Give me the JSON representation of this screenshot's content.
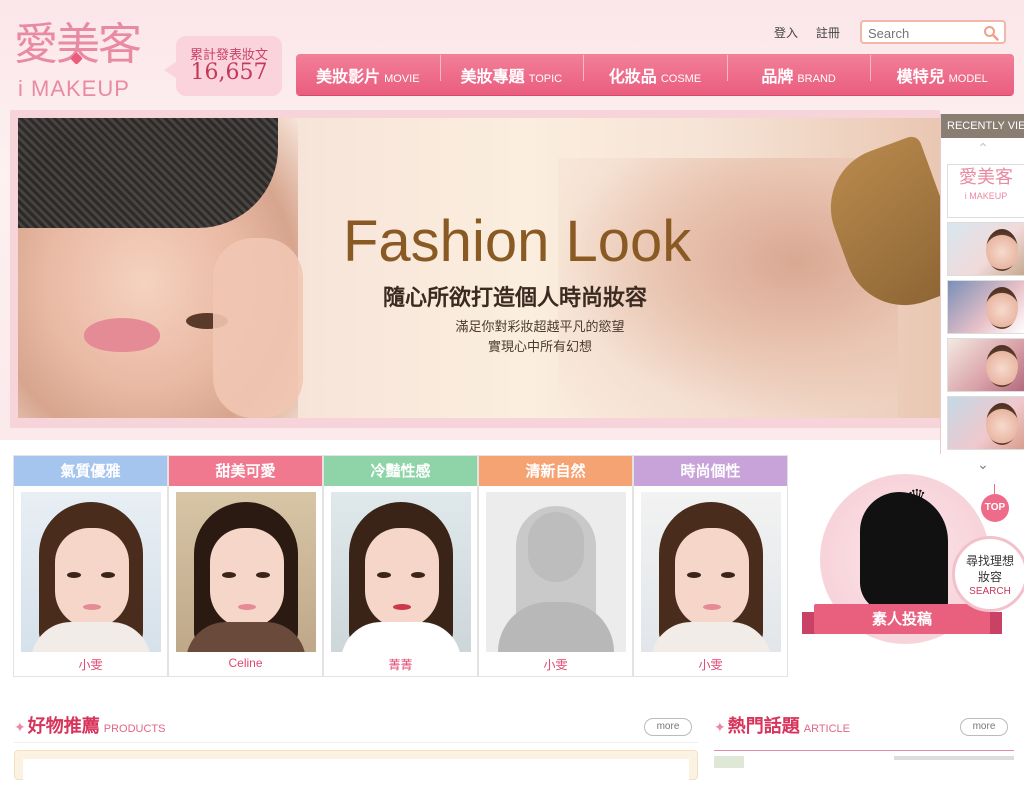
{
  "logo": {
    "cn": "愛美客",
    "en": "i MAKEUP"
  },
  "counter": {
    "label": "累計發表妝文",
    "value": "16,657"
  },
  "toplinks": {
    "login": "登入",
    "register": "註冊"
  },
  "search": {
    "placeholder": "Search"
  },
  "nav": [
    {
      "cn": "美妝影片",
      "en": "MOVIE"
    },
    {
      "cn": "美妝專題",
      "en": "TOPIC"
    },
    {
      "cn": "化妝品",
      "en": "COSME"
    },
    {
      "cn": "品牌",
      "en": "BRAND"
    },
    {
      "cn": "模特兒",
      "en": "MODEL"
    }
  ],
  "banner": {
    "title": "Fashion Look",
    "subtitle": "隨心所欲打造個人時尚妝容",
    "line1": "滿足你對彩妝超越平凡的慾望",
    "line2": "實現心中所有幻想"
  },
  "recent": {
    "header": "RECENTLY VIEWED",
    "thumb_logo_cn": "愛美客",
    "thumb_logo_en": "i MAKEUP"
  },
  "categories": [
    {
      "title": "氣質優雅",
      "name": "小雯",
      "color": "#a5c4ee"
    },
    {
      "title": "甜美可愛",
      "name": "Celine",
      "color": "#f0798f"
    },
    {
      "title": "冷豔性感",
      "name": "菁菁",
      "color": "#8fd3a8"
    },
    {
      "title": "清新自然",
      "name": "小雯",
      "color": "#f6a374"
    },
    {
      "title": "時尚個性",
      "name": "小雯",
      "color": "#c7a3d9"
    }
  ],
  "promo": {
    "ribbon": "素人投稿",
    "find_l1": "尋找理想",
    "find_l2": "妝容",
    "find_l3": "SEARCH",
    "top": "TOP"
  },
  "sections": {
    "products": {
      "title": "好物推薦",
      "en": "PRODUCTS",
      "more": "more"
    },
    "article": {
      "title": "熱門話題",
      "en": "ARTICLE",
      "more": "more"
    }
  },
  "colors": {
    "accent": "#ea5d7f",
    "brand_pink": "#e98aa3",
    "gold": "#8a5a24"
  }
}
